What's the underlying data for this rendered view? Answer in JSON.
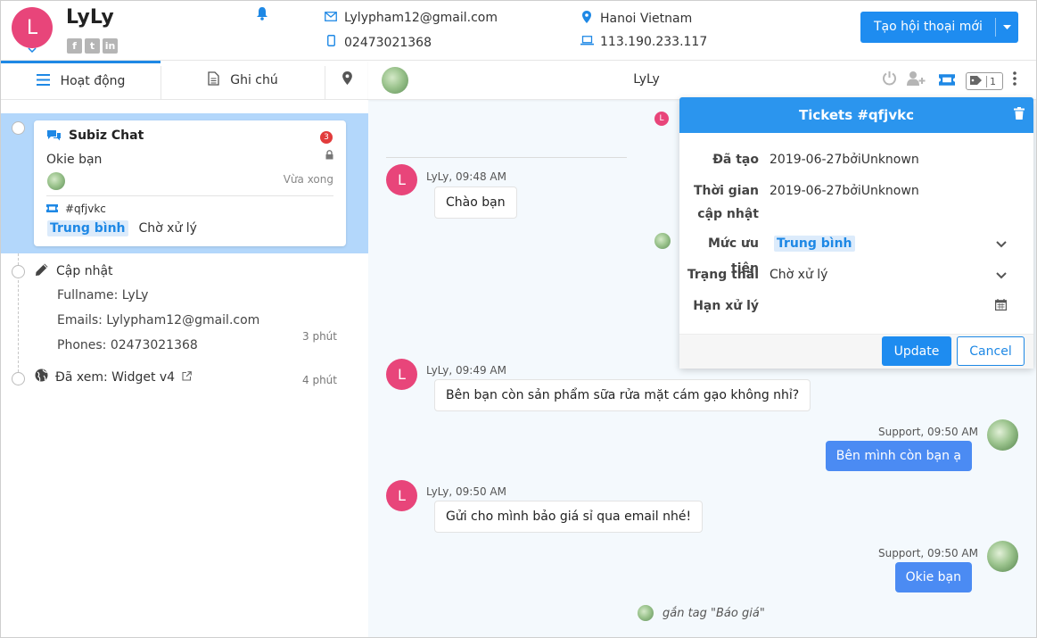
{
  "header": {
    "avatar_letter": "L",
    "name": "LyLy",
    "email": "Lylypham12@gmail.com",
    "phone": "02473021368",
    "location": "Hanoi Vietnam",
    "ip": "113.190.233.117",
    "new_conversation_label": "Tạo hội thoại mới"
  },
  "left": {
    "tabs": [
      {
        "label": "Hoạt động"
      },
      {
        "label": "Ghi chú"
      }
    ],
    "card": {
      "title": "Subiz Chat",
      "unread": "3",
      "last_message": "Okie bạn",
      "time": "Vừa xong",
      "ticket_id": "#qfjvkc",
      "priority": "Trung bình",
      "status": "Chờ xử lý"
    },
    "update_activity": {
      "title": "Cập nhật",
      "fullname": "Fullname: LyLy",
      "emails": "Emails: Lylypham12@gmail.com",
      "phones": "Phones: 02473021368",
      "time": "3 phút"
    },
    "view_activity": {
      "title": "Đã xem: Widget v4",
      "time": "4 phút"
    }
  },
  "chat": {
    "contact_name": "LyLy",
    "tag_count": "1",
    "messages": [
      {
        "sender": "LyLy, 09:48 AM",
        "text": "Chào bạn"
      },
      {
        "sender": "LyLy, 09:49 AM",
        "text": "Bên bạn còn sản phẩm sữa rửa mặt cám gạo không nhỉ?"
      },
      {
        "sender": "Support, 09:50 AM",
        "text": "Bên mình còn bạn ạ"
      },
      {
        "sender": "LyLy, 09:50 AM",
        "text": "Gửi cho mình bảo giá sỉ qua email nhé!"
      },
      {
        "sender": "Support, 09:50 AM",
        "text": "Okie bạn"
      }
    ],
    "tag_note": "gắn tag \"Báo giá\""
  },
  "ticket": {
    "title": "Tickets #qfjvkc",
    "created_label": "Đã tạo",
    "created_value": "2019-06-27bởiUnknown",
    "updated_label_1": "Thời gian",
    "updated_label_2": "cập nhật",
    "updated_value": "2019-06-27bởiUnknown",
    "priority_label": "Mức ưu tiên",
    "priority_value": "Trung bình",
    "status_label": "Trạng thái",
    "status_value": "Chờ xử lý",
    "deadline_label": "Hạn xử lý",
    "update_button": "Update",
    "cancel_button": "Cancel"
  },
  "colors": {
    "accent": "#1e88e5",
    "avatar": "#e8457a",
    "selected_row": "#b3d7fb",
    "agent_bubble": "#4b8bf3"
  }
}
